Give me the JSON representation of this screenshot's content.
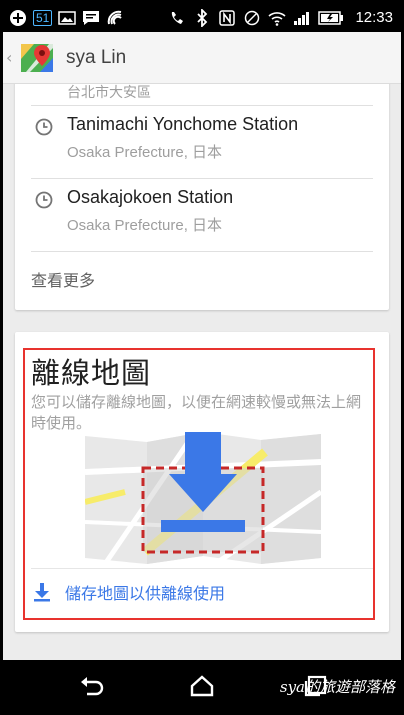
{
  "status_bar": {
    "badge": "51",
    "time": "12:33"
  },
  "action_bar": {
    "title": "sya Lin"
  },
  "history": {
    "cut_address": "台北市大安區",
    "places": [
      {
        "name": "Tanimachi Yonchome Station",
        "subtitle": "Osaka Prefecture, 日本"
      },
      {
        "name": "Osakajokoen Station",
        "subtitle": "Osaka Prefecture, 日本"
      }
    ],
    "see_more": "查看更多"
  },
  "offline": {
    "title": "離線地圖",
    "description": "您可以儲存離線地圖，以便在網速較慢或無法上網時使用。",
    "save_label": "儲存地圖以供離線使用"
  },
  "watermark": "sya的旅遊部落格",
  "colors": {
    "accent_blue": "#3b78e7",
    "highlight_red": "#e8332e"
  }
}
